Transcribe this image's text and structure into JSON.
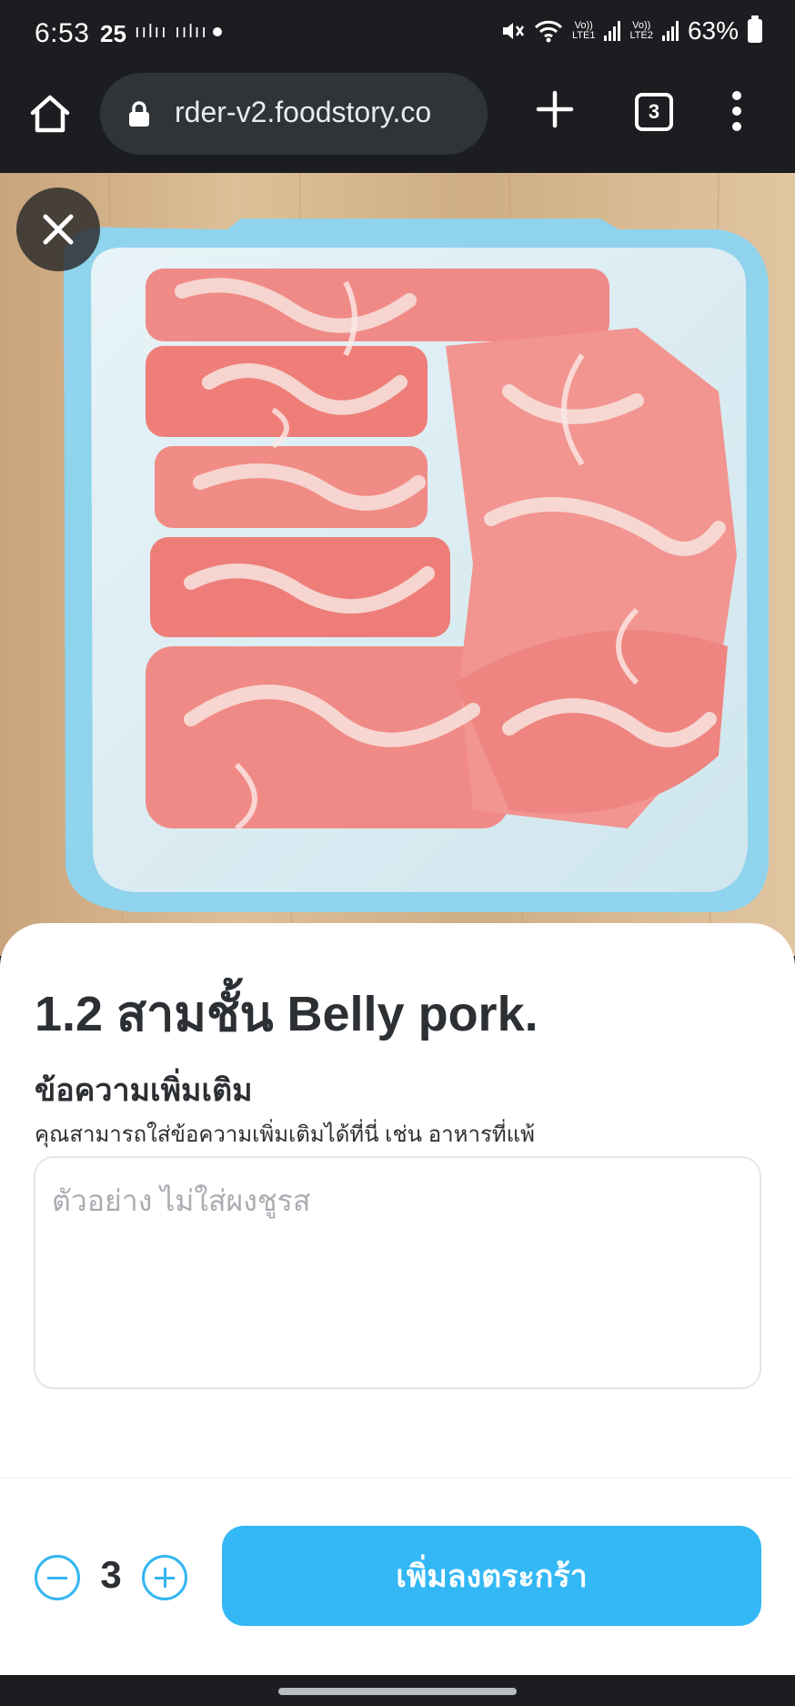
{
  "status_bar": {
    "time": "6:53",
    "temp": "25",
    "battery": "63%",
    "lte1": "LTE1",
    "lte2": "LTE2",
    "volte": "Vo))"
  },
  "browser": {
    "url": "rder-v2.foodstory.co",
    "tab_count": "3"
  },
  "product": {
    "title": "1.2 สามชั้น Belly pork."
  },
  "note": {
    "heading": "ข้อความเพิ่มเติม",
    "hint": "คุณสามารถใส่ข้อความเพิ่มเติมได้ที่นี่ เช่น อาหารที่แพ้",
    "placeholder": "ตัวอย่าง ไม่ใส่ผงชูรส"
  },
  "order": {
    "quantity": "3",
    "add_to_cart_label": "เพิ่มลงตระกร้า"
  },
  "colors": {
    "accent": "#33b8f5",
    "title_text": "#2c2f33",
    "system_bar": "#1b1d20"
  },
  "icons": {
    "close": "close-icon",
    "home": "home-icon",
    "lock": "lock-icon",
    "new_tab": "plus-icon",
    "menu": "more-vertical-icon",
    "minus": "minus-circle-icon",
    "plus": "plus-circle-icon"
  }
}
